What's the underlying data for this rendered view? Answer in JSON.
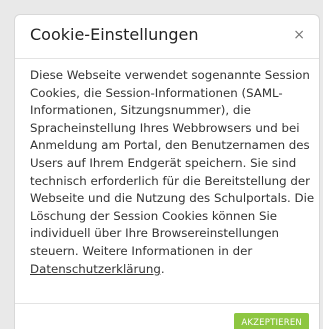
{
  "dialog": {
    "title": "Cookie-Einstellungen",
    "close_label": "×",
    "body_text": "Diese Webseite verwendet sogenannte Session Cookies, die Session-Informationen (SAML-Informationen, Sitzungsnummer), die Spracheinstellung Ihres Webbrowsers und bei Anmeldung am Portal, den Benutzernamen des Users auf Ihrem Endgerät speichern. Sie sind technisch erforderlich für die Bereitstellung der Webseite und die Nutzung des Schulportals. Die Löschung der Session Cookies können Sie individuell über Ihre Browsereinstellungen steuern. Weitere Informationen in der ",
    "link_text": "Datenschutzerklärung",
    "body_suffix": ".",
    "accept_label": "AKZEPTIEREN"
  },
  "colors": {
    "accent": "#8dc641",
    "backdrop": "#e9e9e9"
  }
}
